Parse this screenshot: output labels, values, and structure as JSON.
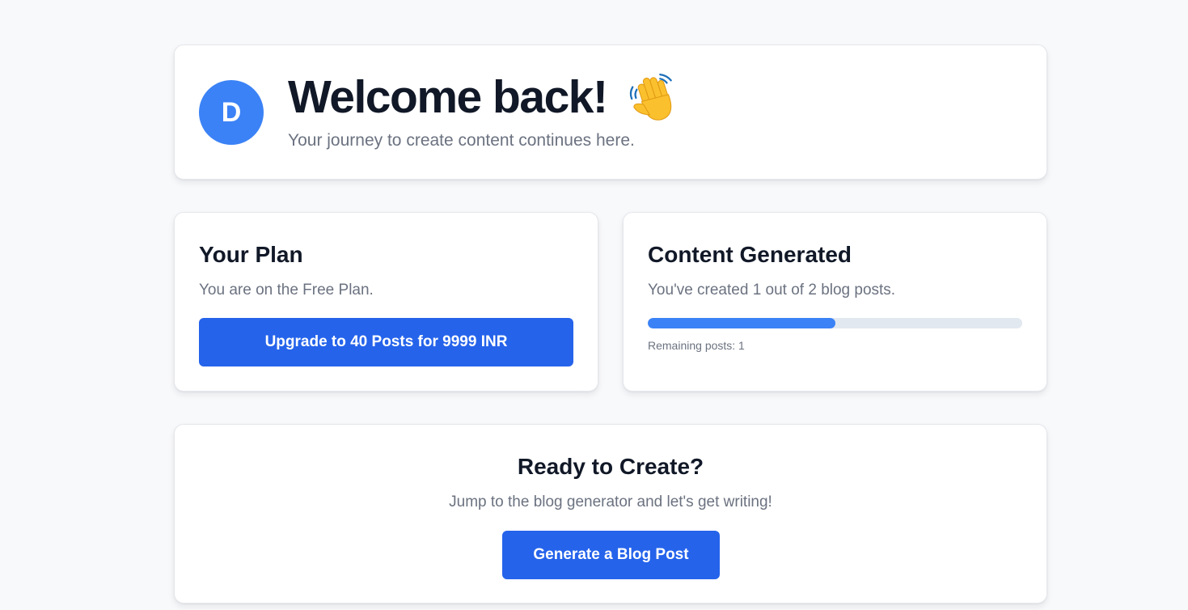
{
  "welcome": {
    "avatar_initial": "D",
    "title": "Welcome back!",
    "wave_icon": "waving-hand",
    "subtitle": "Your journey to create content continues here."
  },
  "plan": {
    "title": "Your Plan",
    "text": "You are on the Free Plan.",
    "upgrade_label": "Upgrade to 40 Posts for 9999 INR"
  },
  "usage": {
    "title": "Content Generated",
    "text": "You've created 1 out of 2 blog posts.",
    "progress": 0.5,
    "remaining": "Remaining posts: 1"
  },
  "cta": {
    "title": "Ready to Create?",
    "text": "Jump to the blog generator and let's get writing!",
    "button_label": "Generate a Blog Post"
  },
  "colors": {
    "accent": "#2563eb",
    "avatar": "#3b82f6",
    "progress_fill": "#3b82f6",
    "progress_track": "#e2e8f0",
    "background": "#f8f9fb"
  }
}
